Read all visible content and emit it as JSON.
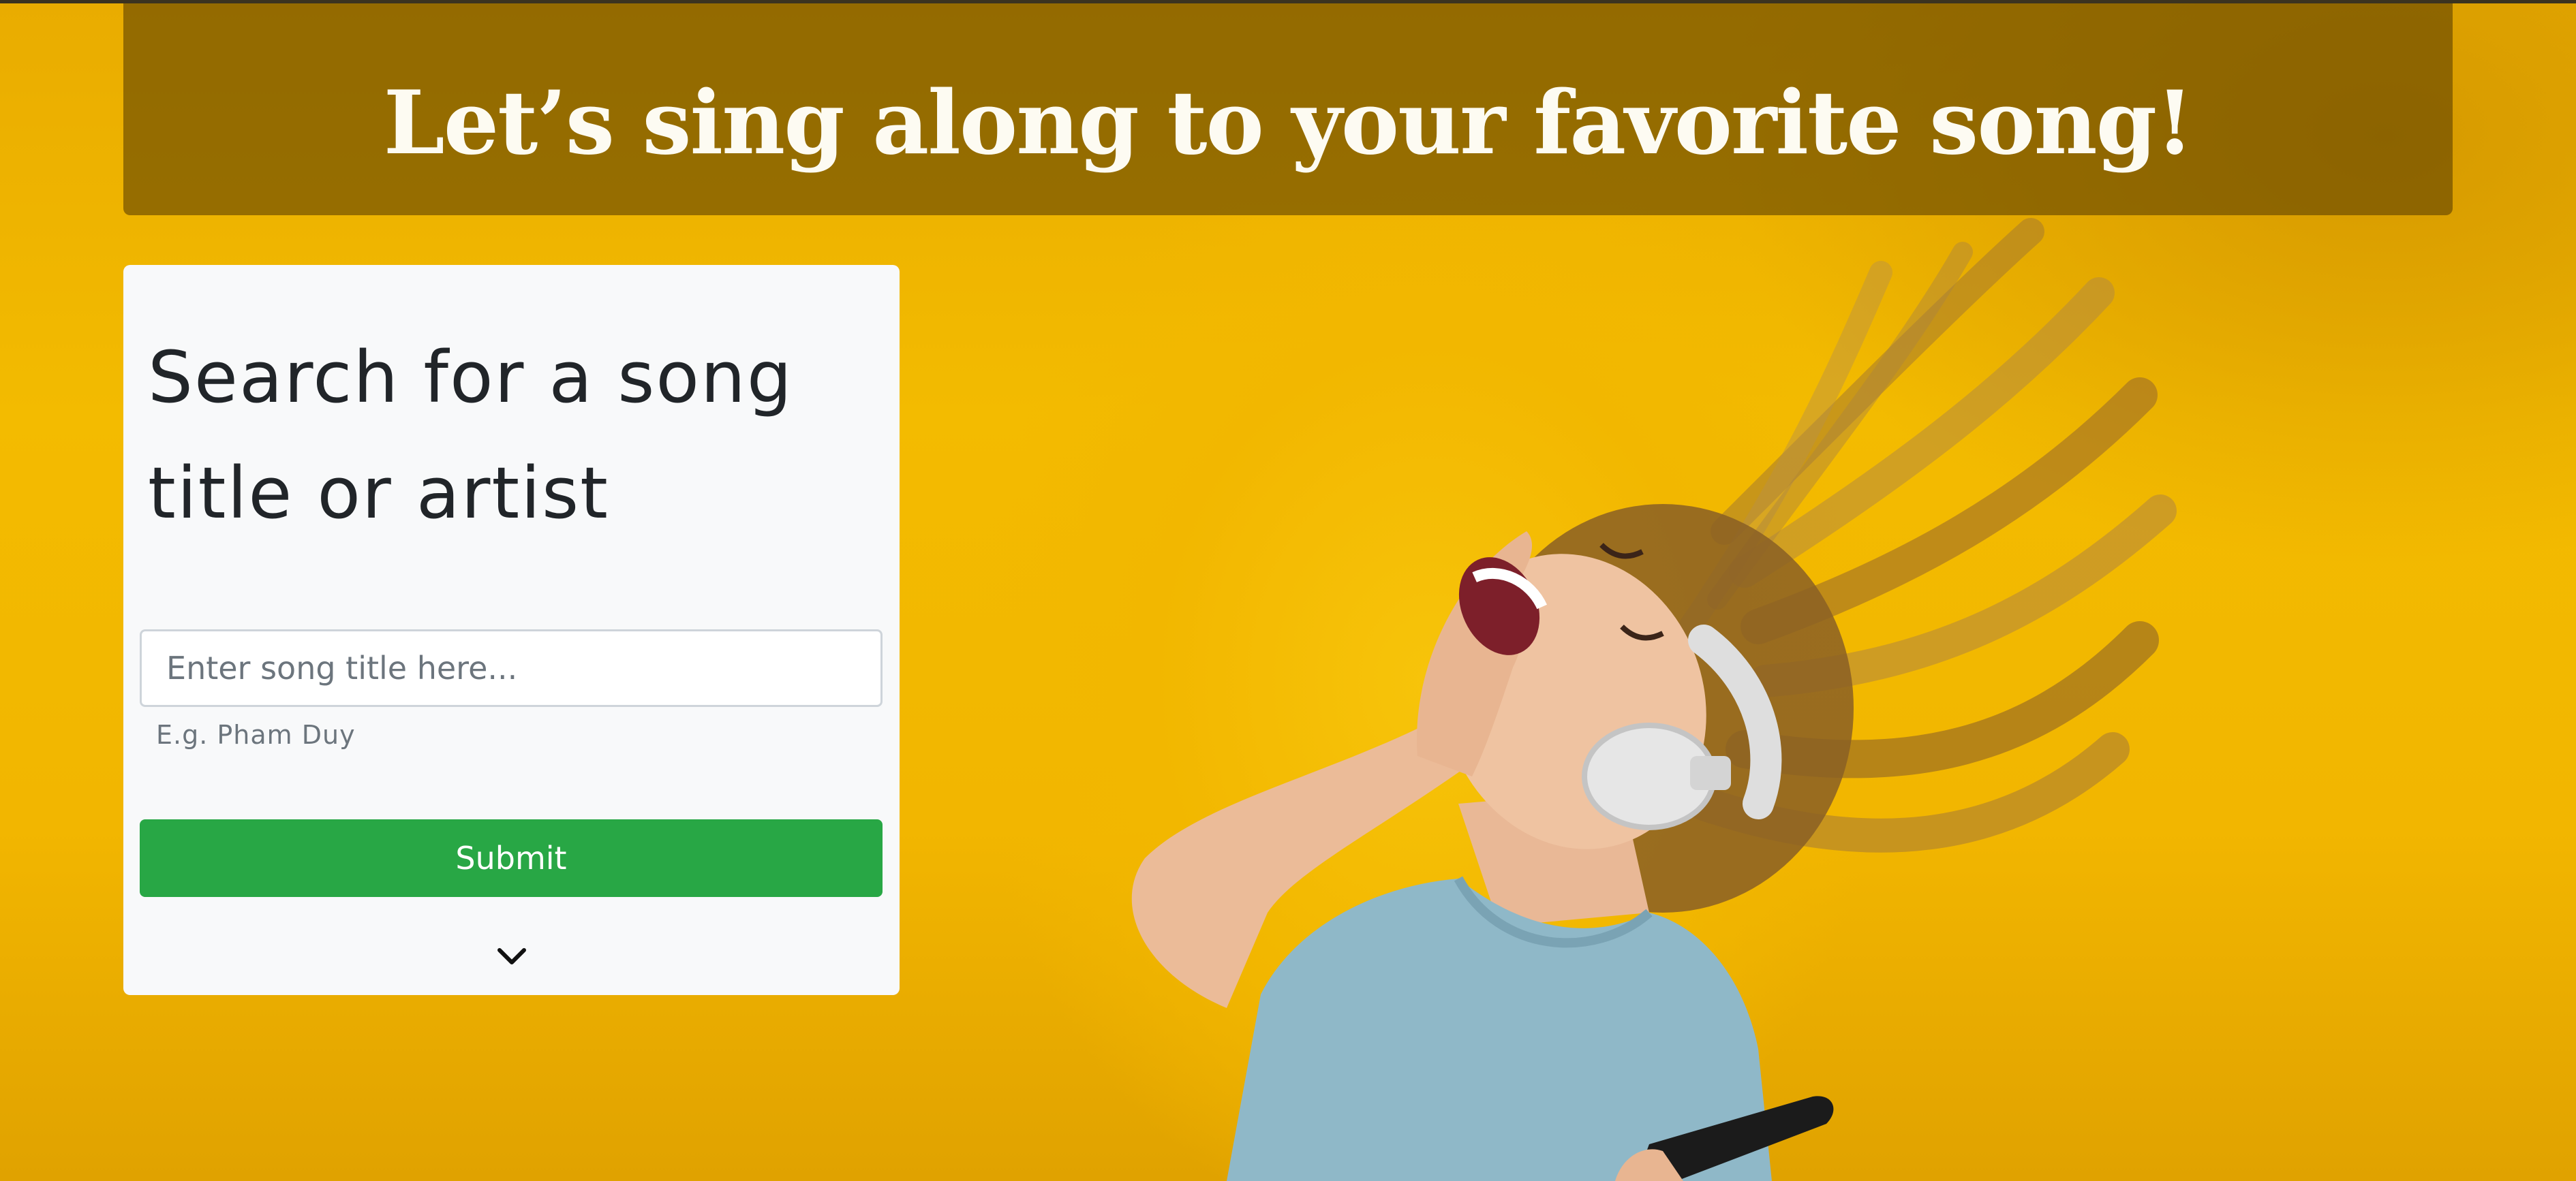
{
  "header": {
    "title": "Let’s sing along to your favorite song!"
  },
  "hero": {
    "image_description_icon": "woman-singing-with-headphones-image"
  },
  "search_card": {
    "heading": "Search for a song title or artist",
    "input": {
      "value": "",
      "placeholder": "Enter song title here..."
    },
    "hint": "E.g. Pham Duy",
    "submit_label": "Submit",
    "expand_icon": "chevron-down-icon"
  },
  "colors": {
    "background": "#f2b600",
    "header_overlay": "#604200",
    "header_text": "#fdfbf2",
    "card_background": "#f8f9fa",
    "submit_button": "#28a745"
  }
}
